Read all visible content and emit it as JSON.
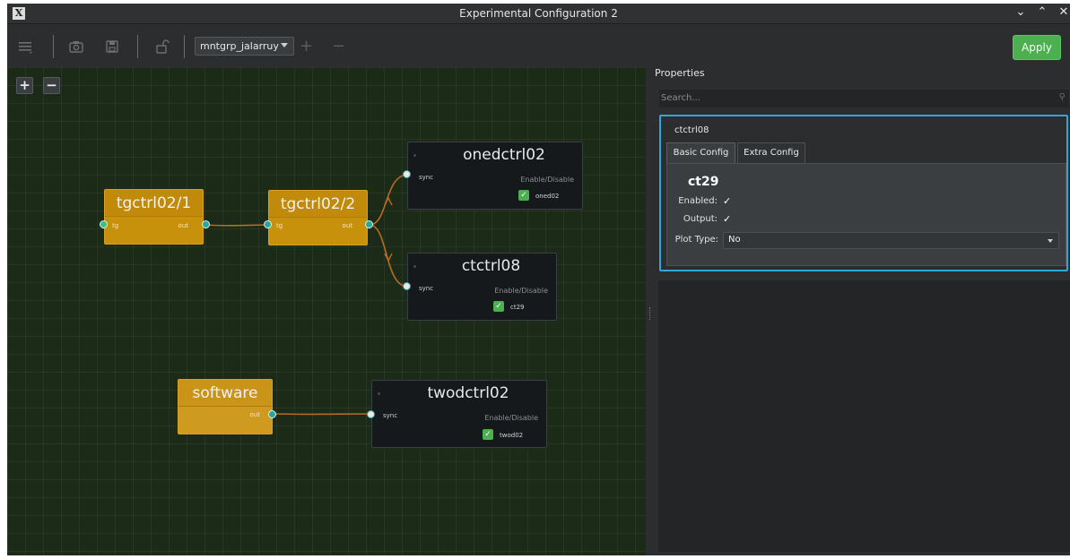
{
  "window": {
    "title": "Experimental Configuration 2",
    "app_icon": "X",
    "controls": {
      "minimize": "⌄",
      "maximize": "⌃",
      "close": "✕"
    }
  },
  "toolbar": {
    "menu_icon": "menu-icon",
    "measurement_group": "mntgrp_jalarruy",
    "add_label": "+",
    "remove_label": "−",
    "apply_label": "Apply"
  },
  "canvas": {
    "zoom_in": "+",
    "zoom_out": "−",
    "nodes": {
      "tg1": {
        "name": "tgctrl02/1",
        "in_port": "tg",
        "out_port": "out"
      },
      "tg2": {
        "name": "tgctrl02/2",
        "in_port": "tg",
        "out_port": "out"
      },
      "software": {
        "name": "software",
        "out_port": "out"
      },
      "onedctrl": {
        "name": "onedctrl02",
        "sync": "sync",
        "enable_label": "Enable/Disable",
        "channel": "oned02",
        "checked": true
      },
      "ctctrl": {
        "name": "ctctrl08",
        "sync": "sync",
        "enable_label": "Enable/Disable",
        "channel": "ct29",
        "checked": true
      },
      "twodctrl": {
        "name": "twodctrl02",
        "sync": "sync",
        "enable_label": "Enable/Disable",
        "channel": "twod02",
        "checked": true
      }
    },
    "colors": {
      "trigger_node": "#c8910c",
      "link": "#b86a22",
      "port": "#2aa6a0",
      "checkbox": "#4caf50"
    }
  },
  "properties": {
    "title": "Properties",
    "search_placeholder": "Search...",
    "selected": "ctctrl08",
    "tabs": [
      "Basic Config",
      "Extra Config"
    ],
    "active_tab": "Basic Config",
    "channel": "ct29",
    "enabled_label": "Enabled:",
    "enabled_mark": "✓",
    "output_label": "Output:",
    "output_mark": "✓",
    "plot_type_label": "Plot Type:",
    "plot_type_value": "No",
    "accent": "#2fa8d8"
  }
}
